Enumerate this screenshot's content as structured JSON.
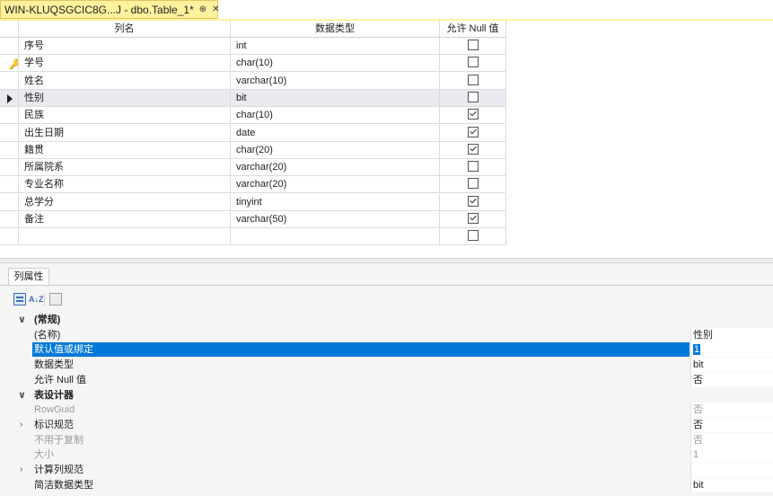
{
  "tab": {
    "title": "WIN-KLUQSGCIC8G...J - dbo.Table_1*",
    "pin_glyph": "⊕",
    "close_glyph": "✕"
  },
  "grid": {
    "headers": {
      "name": "列名",
      "type": "数据类型",
      "null": "允许 Null 值"
    },
    "current_row": 3,
    "key_row": 1,
    "rows": [
      {
        "name": "序号",
        "type": "int",
        "allow_null": false
      },
      {
        "name": "学号",
        "type": "char(10)",
        "allow_null": false
      },
      {
        "name": "姓名",
        "type": "varchar(10)",
        "allow_null": false
      },
      {
        "name": "性别",
        "type": "bit",
        "allow_null": false
      },
      {
        "name": "民族",
        "type": "char(10)",
        "allow_null": true
      },
      {
        "name": "出生日期",
        "type": "date",
        "allow_null": true
      },
      {
        "name": "籍贯",
        "type": "char(20)",
        "allow_null": true
      },
      {
        "name": "所属院系",
        "type": "varchar(20)",
        "allow_null": false
      },
      {
        "name": "专业名称",
        "type": "varchar(20)",
        "allow_null": false
      },
      {
        "name": "总学分",
        "type": "tinyint",
        "allow_null": true
      },
      {
        "name": "备注",
        "type": "varchar(50)",
        "allow_null": true
      },
      {
        "name": "",
        "type": "",
        "allow_null": false
      }
    ]
  },
  "properties": {
    "tab_label": "列属性",
    "toolbar": {
      "categorized_icon": "categorized-icon",
      "alphabetical_label": "A↓Z",
      "pages_icon": "property-pages-icon"
    },
    "rows": [
      {
        "kind": "category",
        "name": "(常规)",
        "value": "",
        "expander": "∨"
      },
      {
        "kind": "item",
        "name": "(名称)",
        "value": "性别"
      },
      {
        "kind": "item",
        "name": "默认值或绑定",
        "value": "1",
        "selected": true
      },
      {
        "kind": "item",
        "name": "数据类型",
        "value": "bit"
      },
      {
        "kind": "item",
        "name": "允许 Null 值",
        "value": "否"
      },
      {
        "kind": "category",
        "name": "表设计器",
        "value": "",
        "expander": "∨"
      },
      {
        "kind": "item",
        "name": "RowGuid",
        "value": "否",
        "dim": true
      },
      {
        "kind": "item",
        "name": "标识规范",
        "value": "否",
        "expander": "›"
      },
      {
        "kind": "item",
        "name": "不用于复制",
        "value": "否",
        "dim": true
      },
      {
        "kind": "item",
        "name": "大小",
        "value": "1",
        "dim": true
      },
      {
        "kind": "item",
        "name": "计算列规范",
        "value": "",
        "expander": "›"
      },
      {
        "kind": "item",
        "name": "简洁数据类型",
        "value": "bit"
      }
    ]
  },
  "colors": {
    "tab_active": "#fff29d",
    "selection": "#0078d7",
    "current_row": "#e8eaf0"
  }
}
